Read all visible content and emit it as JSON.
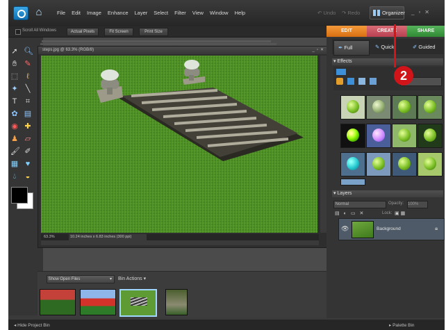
{
  "menu": [
    "File",
    "Edit",
    "Image",
    "Enhance",
    "Layer",
    "Select",
    "Filter",
    "View",
    "Window",
    "Help"
  ],
  "toolbar": {
    "undo": "Undo",
    "redo": "Redo",
    "organizer": "Organizer"
  },
  "options": {
    "scroll_all_label": "Scroll All Windows",
    "buttons": [
      "Actual Pixels",
      "Fit Screen",
      "Print Size"
    ]
  },
  "tabs": [
    "EDIT",
    "CREATE",
    "SHARE"
  ],
  "modes": [
    "Full",
    "Quick",
    "Guided"
  ],
  "document": {
    "title": "steps.jpg @ 63.3% (RGB/8)",
    "zoom": "63.3%",
    "info": "10.24 inches x 6.83 inches (300 ppi)"
  },
  "bin": {
    "show_select": "Show Open Files",
    "actions": "Bin Actions"
  },
  "panels": {
    "effects": "Effects",
    "layers": "Layers",
    "blend_mode": "Normal",
    "opacity_label": "Opacity:",
    "opacity_value": "100%",
    "lock_label": "Lock:",
    "layer_name": "Background"
  },
  "bottom": {
    "hide_bin": "Hide Project Bin",
    "palette_bin": "Palette Bin"
  },
  "callout": {
    "number": "2"
  },
  "colors": {
    "edit": "#e57f20",
    "create": "#c24a5a",
    "share": "#3f9a43",
    "callout": "#d0141a"
  }
}
